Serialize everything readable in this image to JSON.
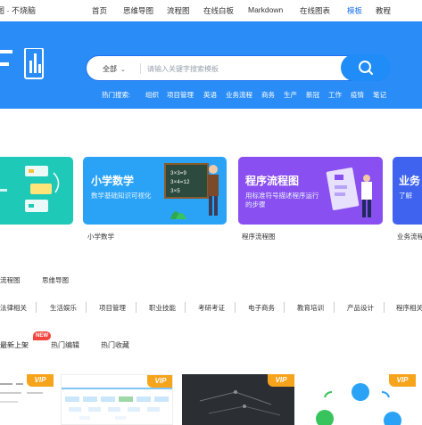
{
  "topnav": {
    "brand": "图 · 不烧脑",
    "items": [
      {
        "label": "首页"
      },
      {
        "label": "思维导图"
      },
      {
        "label": "流程图"
      },
      {
        "label": "在线白板"
      },
      {
        "label": "Markdown"
      },
      {
        "label": "在线图表"
      },
      {
        "label": "模板"
      },
      {
        "label": "教程"
      }
    ],
    "active": "模板"
  },
  "search": {
    "category": "全部",
    "placeholder": "请输入关键字搜索模板",
    "icon": "search-icon"
  },
  "hot": {
    "label": "热门搜索:",
    "items": [
      "组织",
      "项目管理",
      "英语",
      "业务流程",
      "商务",
      "生产",
      "新冠",
      "工作",
      "疫情",
      "笔记"
    ]
  },
  "cards": [
    {
      "title": "",
      "subtitle": "",
      "caption": "",
      "color": "#1fc9b8"
    },
    {
      "title": "小学数学",
      "subtitle": "数学基础知识可视化",
      "caption": "小学数学",
      "color": "#2aa3f7"
    },
    {
      "title": "程序流程图",
      "subtitle1": "用标准符号描述程序运行",
      "subtitle2": "的步骤",
      "caption": "程序流程图",
      "color": "#8a4ff0"
    },
    {
      "title": "业务",
      "subtitle": "了解",
      "caption": "业务流程",
      "color": "#3f63ef"
    }
  ],
  "tabs": [
    "流程图",
    "思维导图"
  ],
  "categories": [
    "法律相关",
    "生活娱乐",
    "项目管理",
    "职业技能",
    "考研考证",
    "电子商务",
    "教育培训",
    "产品设计",
    "程序相关"
  ],
  "subtabs": {
    "items": [
      "最新上架",
      "热门编辑",
      "热门收藏"
    ],
    "badge": "NEW"
  },
  "vip_label": "VIP",
  "colors": {
    "accent": "#1f6ff0",
    "banner": "#2a8df7",
    "vip": "#f7a41d",
    "new_badge": "#f2453d"
  }
}
